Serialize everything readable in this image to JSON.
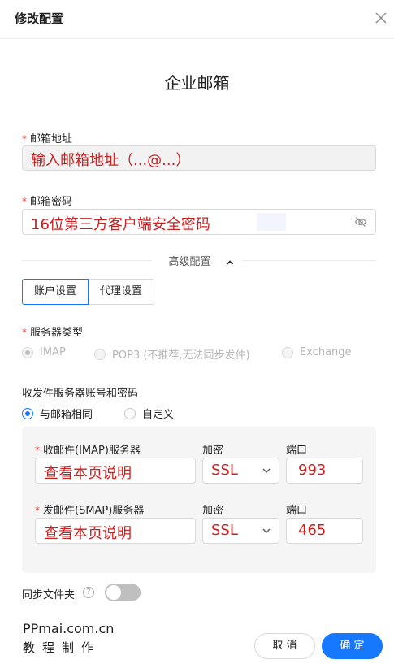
{
  "dialog": {
    "title": "修改配置"
  },
  "heading": "企业邮箱",
  "email": {
    "label": "邮箱地址",
    "value": "输入邮箱地址（...@...）"
  },
  "password": {
    "label": "邮箱密码",
    "value": "16位第三方客户端安全密码"
  },
  "advanced": {
    "label": "高级配置"
  },
  "tabs": [
    {
      "label": "账户设置"
    },
    {
      "label": "代理设置"
    }
  ],
  "server_type": {
    "label": "服务器类型",
    "options": [
      "IMAP",
      "POP3 (不推荐,无法同步发件)",
      "Exchange"
    ],
    "selected": "IMAP"
  },
  "credentials": {
    "label": "收发件服务器账号和密码",
    "options": [
      "与邮箱相同",
      "自定义"
    ],
    "selected": "与邮箱相同"
  },
  "imap": {
    "label": "收邮件(IMAP)服务器",
    "value": "查看本页说明",
    "encryption_label": "加密",
    "encryption": "SSL",
    "port_label": "端口",
    "port": "993"
  },
  "smtp": {
    "label": "发邮件(SMAP)服务器",
    "value": "查看本页说明",
    "encryption_label": "加密",
    "encryption": "SSL",
    "port_label": "端口",
    "port": "465"
  },
  "sync": {
    "label": "同步文件夹",
    "help": "?",
    "enabled": false
  },
  "watermark": {
    "line1": "PPmai.com.cn",
    "line2": "教程制作"
  },
  "buttons": {
    "cancel": "取 消",
    "ok": "确 定"
  },
  "colors": {
    "primary": "#1677ff",
    "annotation_red": "#cc1f1f",
    "required": "#e23b3b"
  }
}
